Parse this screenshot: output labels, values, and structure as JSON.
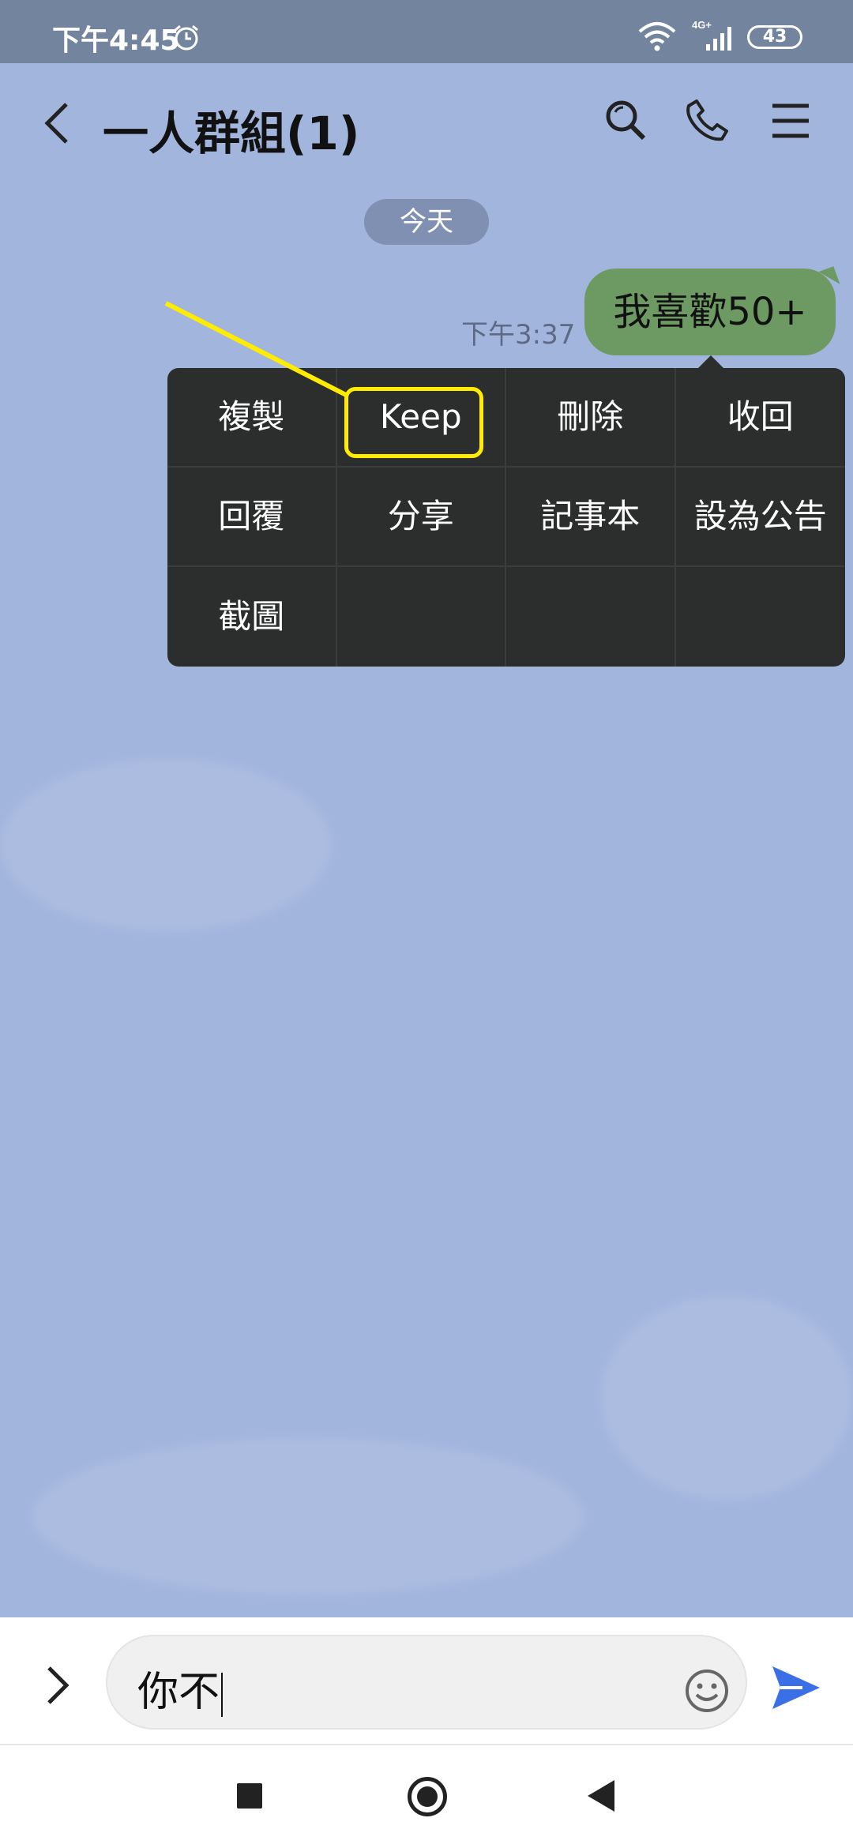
{
  "status_bar": {
    "time": "下午4:45",
    "network_label": "4G+",
    "battery": "43"
  },
  "header": {
    "title": "一人群組(1)"
  },
  "chat": {
    "date_separator": "今天",
    "messages": [
      {
        "text": "我喜歡50+",
        "time": "下午3:37",
        "sender": "self"
      }
    ]
  },
  "context_menu": {
    "items": [
      "複製",
      "Keep",
      "刪除",
      "收回",
      "回覆",
      "分享",
      "記事本",
      "設為公告",
      "截圖",
      "",
      "",
      ""
    ],
    "highlighted": "Keep"
  },
  "composer": {
    "value": "你不"
  },
  "colors": {
    "background": "#a2b5dd",
    "bubble_self": "#6c9a62",
    "menu_bg": "#2c2e2d",
    "highlight": "#ffec00",
    "send": "#3b6fe6"
  }
}
